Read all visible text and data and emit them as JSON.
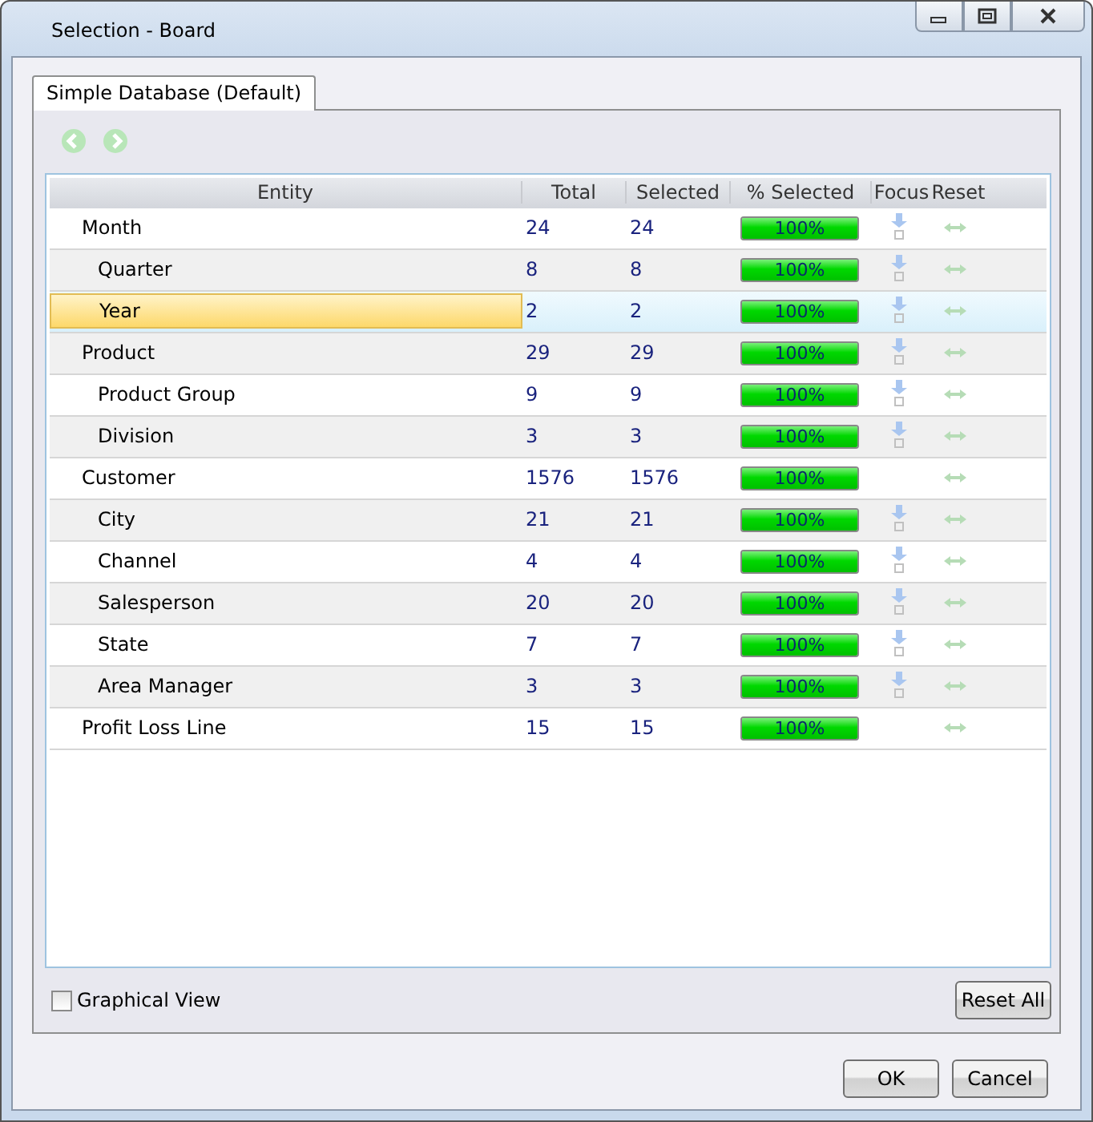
{
  "window": {
    "title": "Selection - Board"
  },
  "tabs": [
    {
      "label": "Simple Database (Default)",
      "selected": true
    }
  ],
  "columns": [
    "Entity",
    "Total",
    "Selected",
    "% Selected",
    "Focus",
    "Reset"
  ],
  "rows": [
    {
      "entity": "Month",
      "total": "24",
      "selected_count": "24",
      "percent": "100%",
      "level": 1,
      "focus": true,
      "selected": false,
      "children": [
        {
          "entity": "Quarter",
          "total": "8",
          "selected_count": "8",
          "percent": "100%",
          "level": 1,
          "focus": true,
          "selected": false
        },
        {
          "entity": "Year",
          "total": "2",
          "selected_count": "2",
          "percent": "100%",
          "level": 1,
          "focus": true,
          "selected": true
        }
      ]
    },
    {
      "entity": "Product",
      "total": "29",
      "selected_count": "29",
      "percent": "100%",
      "level": 1,
      "focus": true,
      "selected": false,
      "children": [
        {
          "entity": "Product Group",
          "total": "9",
          "selected_count": "9",
          "percent": "100%",
          "level": 1,
          "focus": true,
          "selected": false
        },
        {
          "entity": "Division",
          "total": "3",
          "selected_count": "3",
          "percent": "100%",
          "level": 1,
          "focus": true,
          "selected": false
        }
      ]
    },
    {
      "entity": "Customer",
      "total": "1576",
      "selected_count": "1576",
      "percent": "100%",
      "level": 1,
      "focus": false,
      "selected": false,
      "children": [
        {
          "entity": "City",
          "total": "21",
          "selected_count": "21",
          "percent": "100%",
          "level": 1,
          "focus": true,
          "selected": false
        },
        {
          "entity": "Channel",
          "total": "4",
          "selected_count": "4",
          "percent": "100%",
          "level": 1,
          "focus": true,
          "selected": false
        },
        {
          "entity": "Salesperson",
          "total": "20",
          "selected_count": "20",
          "percent": "100%",
          "level": 1,
          "focus": true,
          "selected": false
        },
        {
          "entity": "State",
          "total": "7",
          "selected_count": "7",
          "percent": "100%",
          "level": 1,
          "focus": true,
          "selected": false
        },
        {
          "entity": "Area Manager",
          "total": "3",
          "selected_count": "3",
          "percent": "100%",
          "level": 1,
          "focus": true,
          "selected": false
        }
      ]
    },
    {
      "entity": "Profit Loss Line",
      "total": "15",
      "selected_count": "15",
      "percent": "100%",
      "level": 1,
      "focus": false,
      "selected": false
    }
  ],
  "graphical_view": {
    "label": "Graphical View",
    "checked": false
  },
  "buttons": {
    "reset_all": "Reset All",
    "ok": "OK",
    "cancel": "Cancel"
  }
}
